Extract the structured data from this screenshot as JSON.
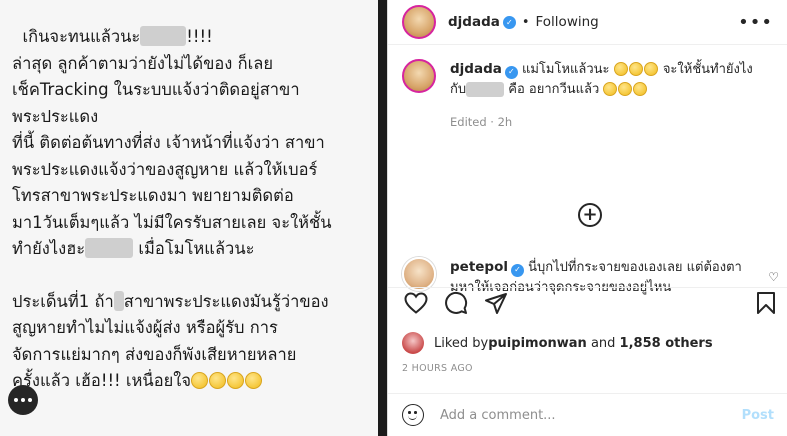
{
  "post_image": {
    "para1": [
      {
        "text": "  เกินจะทนแล้วนะ",
        "blur": 46,
        "after": "!!!!"
      },
      {
        "text": "ล่าสุด ลูกค้าตามว่ายังไม่ได้ของ ก็เลย"
      },
      {
        "text": "เช็คTracking ในระบบแจ้งว่าติดอยู่สาขา"
      },
      {
        "text": "พระประแดง"
      },
      {
        "text": "ที่นี้ ติดต่อต้นทางที่ส่ง เจ้าหน้าที่แจ้งว่า สาขา"
      },
      {
        "text": "พระประแดงแจ้งว่าของสูญหาย แล้วให้เบอร์"
      },
      {
        "text": "โทรสาขาพระประแดงมา พยายามติดต่อ"
      },
      {
        "text": "มา1วันเต็มๆแล้ว ไม่มีใครรับสายเลย จะให้ชั้น"
      },
      {
        "text": "ทำยังไงฮะ",
        "blur": 48,
        "after": " เมื่อโมโหแล้วนะ"
      }
    ],
    "para2": [
      {
        "text": "ประเด็นที่1 ถ้า",
        "blur": 10,
        "after": "สาขาพระประแดงมันรู้ว่าของ"
      },
      {
        "text": "สูญหายทำไมไม่แจ้งผู้ส่ง หรือผู้รับ การ"
      },
      {
        "text": "จัดการแย่มากๆ ส่งของก็พังเสียหายหลาย"
      },
      {
        "text": "ครั้งแล้ว เฮ้อ!!! เหนื่อยใจ",
        "emojis": 4
      }
    ]
  },
  "header": {
    "username": "djdada",
    "separator": "•",
    "follow_status": "Following",
    "more": "•••"
  },
  "caption": {
    "username": "djdada",
    "text_before": " แม่โมโหแล้วนะ",
    "text_mid": " จะให้ชั้นทำยังไง",
    "line2_before": "กับ",
    "line2_after": " คือ อยากวีนแล้ว",
    "edited": "Edited · 2h"
  },
  "comment": {
    "username": "petepol",
    "text": " นี่บุกไปที่กระจายของเองเลย แต่ต้องตามหาให้เจอก่อนว่าจุดกระจายของอยู่ไหน"
  },
  "likes": {
    "prefix": "Liked by ",
    "user": "puipimonwan",
    "middle": " and ",
    "count": "1,858 others"
  },
  "timestamp": "2 HOURS AGO",
  "add_comment": {
    "placeholder": "Add a comment...",
    "post_label": "Post"
  },
  "icons": [
    "heart-icon",
    "comment-icon",
    "share-icon",
    "bookmark-icon",
    "emoji-icon",
    "load-more-icon",
    "more-icon"
  ],
  "colors": {
    "verified": "#3897f0",
    "post_disabled": "#b2dffc",
    "muted": "#8e8e8e"
  }
}
